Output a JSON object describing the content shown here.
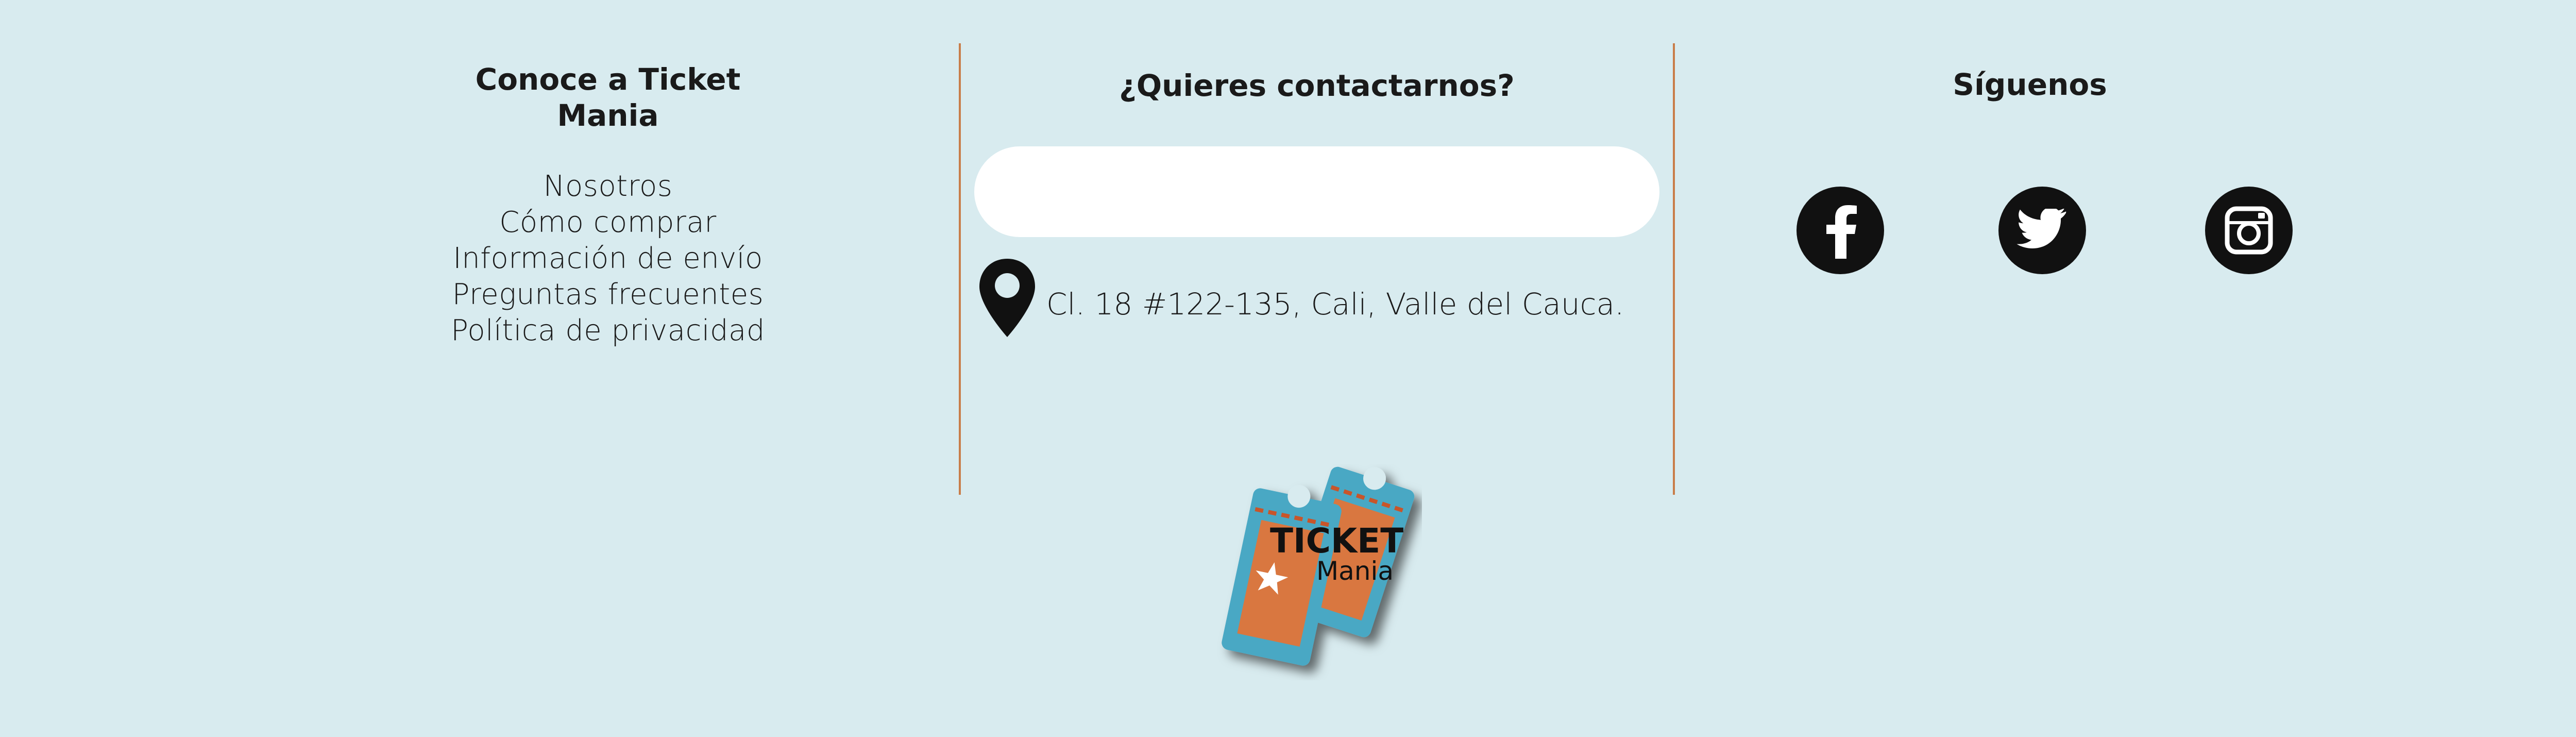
{
  "about": {
    "heading": "Conoce a Ticket Mania",
    "links": [
      "Nosotros",
      "Cómo comprar",
      "Información de envío",
      "Preguntas frecuentes",
      "Política de privacidad"
    ]
  },
  "contact": {
    "heading": "¿Quieres contactarnos?",
    "input_value": "",
    "address": "Cl. 18 #122-135, Cali, Valle del Cauca.",
    "address_icon": "location-pin-icon"
  },
  "social": {
    "heading": "Síguenos",
    "networks": [
      {
        "name": "Facebook",
        "icon": "facebook-icon"
      },
      {
        "name": "Twitter",
        "icon": "twitter-icon"
      },
      {
        "name": "Instagram",
        "icon": "instagram-icon"
      }
    ]
  },
  "logo": {
    "word1": "TICKET",
    "word2": "Mania"
  },
  "colors": {
    "background": "#d8ebef",
    "divider": "#c87d4a",
    "ticket_blue": "#4aa8c4",
    "ticket_orange": "#d9773f"
  }
}
